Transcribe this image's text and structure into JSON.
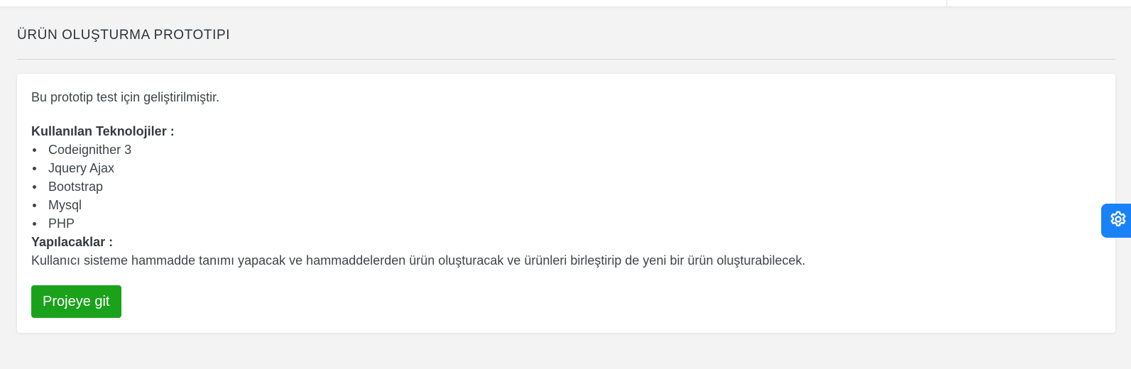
{
  "page": {
    "title": "ÜRÜN OLUŞTURMA PROTOTIPI"
  },
  "card": {
    "intro": "Bu prototip test için geliştirilmiştir.",
    "technologies_heading": "Kullanılan Teknolojiler :",
    "technologies": [
      "Codeignither 3",
      "Jquery Ajax",
      "Bootstrap",
      "Mysql",
      "PHP"
    ],
    "todo_heading": "Yapılacaklar :",
    "todo_text": "Kullanıcı sisteme hammadde tanımı yapacak ve hammaddelerden ürün oluşturacak ve ürünleri birleştirip de yeni bir ürün oluşturabilecek.",
    "button_label": "Projeye git"
  },
  "settings": {
    "icon": "gear-icon"
  },
  "colors": {
    "background": "#f3f3f3",
    "button": "#1ba21b",
    "settings_tab": "#1a82f7"
  }
}
